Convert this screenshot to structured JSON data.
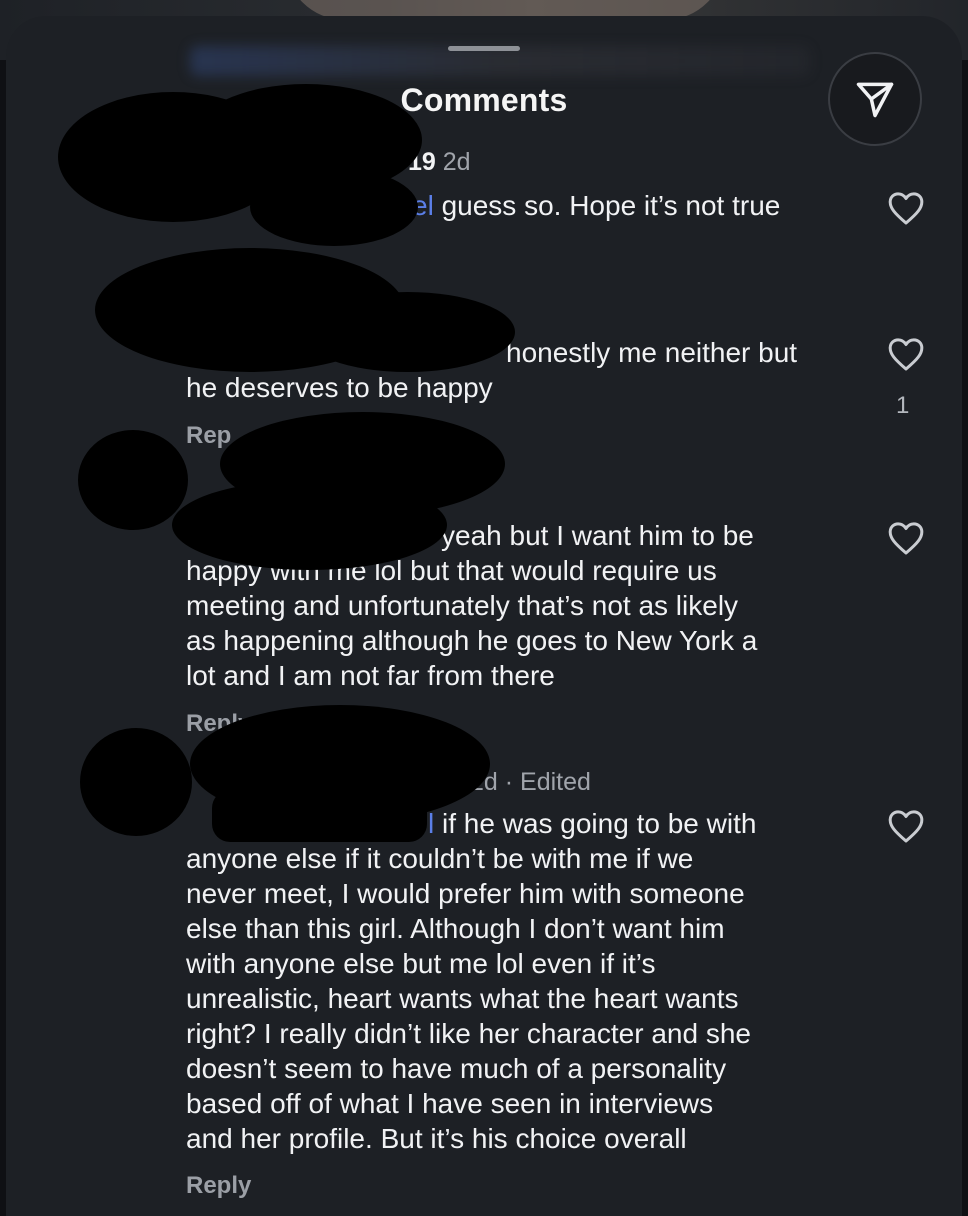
{
  "sheet": {
    "title": "Comments"
  },
  "comments": [
    {
      "meta_count": "19",
      "meta_time": "2d",
      "mention": "el",
      "text": " guess so. Hope it’s not true"
    },
    {
      "text": "honestly me neither but\nhe deserves to be happy",
      "reply": "Rep",
      "likes": "1"
    },
    {
      "text": "yeah but I want him to be\nhappy with me lol but that would require us\nmeeting and unfortunately that’s not as likely\nas happening although he goes to New York a\nlot and I am not far from there",
      "reply": "Reply"
    },
    {
      "meta_time": "2d · Edited",
      "mention": "l",
      "text": " if he was going to be with\nanyone else if it couldn’t be with me if we\nnever meet, I would prefer him with someone\nelse than this girl. Although I don’t want him\nwith anyone else but me lol even if it’s\nunrealistic, heart wants what the heart wants\nright?  I really didn’t like her character and she\ndoesn’t seem to have much of a personality\nbased off of what I have seen in interviews\nand her profile. But it’s his choice overall",
      "reply": "Reply"
    }
  ],
  "colors": {
    "background": "#1d2025",
    "text": "#f1f2f4",
    "meta": "#a0a4ab",
    "mention": "#5b7fe8"
  },
  "icons": [
    "send-icon",
    "heart-icon"
  ]
}
